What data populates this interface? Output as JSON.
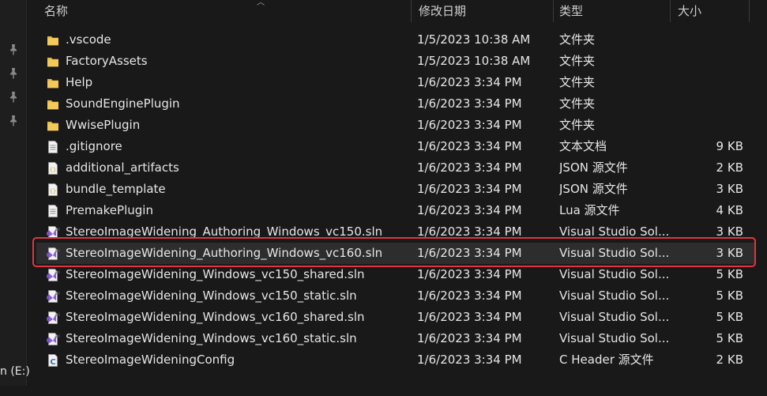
{
  "header": {
    "name": "名称",
    "modified": "修改日期",
    "type": "类型",
    "size": "大小"
  },
  "sidebar": {
    "drive_label": "n (E:)"
  },
  "colors": {
    "folder": "#e8b84a",
    "vs_purple": "#7a4fc2",
    "highlight": "#e0353f"
  },
  "files": [
    {
      "name": ".vscode",
      "modified": "1/5/2023 10:38 AM",
      "type": "文件夹",
      "size": "",
      "icon": "folder-icon"
    },
    {
      "name": "FactoryAssets",
      "modified": "1/5/2023 10:38 AM",
      "type": "文件夹",
      "size": "",
      "icon": "folder-icon"
    },
    {
      "name": "Help",
      "modified": "1/6/2023 3:34 PM",
      "type": "文件夹",
      "size": "",
      "icon": "folder-icon"
    },
    {
      "name": "SoundEnginePlugin",
      "modified": "1/6/2023 3:34 PM",
      "type": "文件夹",
      "size": "",
      "icon": "folder-icon"
    },
    {
      "name": "WwisePlugin",
      "modified": "1/6/2023 3:34 PM",
      "type": "文件夹",
      "size": "",
      "icon": "folder-icon"
    },
    {
      "name": ".gitignore",
      "modified": "1/6/2023 3:34 PM",
      "type": "文本文档",
      "size": "9 KB",
      "icon": "text-file-icon"
    },
    {
      "name": "additional_artifacts",
      "modified": "1/6/2023 3:34 PM",
      "type": "JSON 源文件",
      "size": "2 KB",
      "icon": "json-file-icon"
    },
    {
      "name": "bundle_template",
      "modified": "1/6/2023 3:34 PM",
      "type": "JSON 源文件",
      "size": "3 KB",
      "icon": "json-file-icon"
    },
    {
      "name": "PremakePlugin",
      "modified": "1/6/2023 3:34 PM",
      "type": "Lua 源文件",
      "size": "4 KB",
      "icon": "text-file-icon"
    },
    {
      "name": "StereoImageWidening_Authoring_Windows_vc150.sln",
      "modified": "1/6/2023 3:34 PM",
      "type": "Visual Studio Sol...",
      "size": "3 KB",
      "icon": "vs-solution-icon"
    },
    {
      "name": "StereoImageWidening_Authoring_Windows_vc160.sln",
      "modified": "1/6/2023 3:34 PM",
      "type": "Visual Studio Sol...",
      "size": "3 KB",
      "icon": "vs-solution-icon",
      "selected": true
    },
    {
      "name": "StereoImageWidening_Windows_vc150_shared.sln",
      "modified": "1/6/2023 3:34 PM",
      "type": "Visual Studio Sol...",
      "size": "5 KB",
      "icon": "vs-solution-icon"
    },
    {
      "name": "StereoImageWidening_Windows_vc150_static.sln",
      "modified": "1/6/2023 3:34 PM",
      "type": "Visual Studio Sol...",
      "size": "5 KB",
      "icon": "vs-solution-icon"
    },
    {
      "name": "StereoImageWidening_Windows_vc160_shared.sln",
      "modified": "1/6/2023 3:34 PM",
      "type": "Visual Studio Sol...",
      "size": "5 KB",
      "icon": "vs-solution-icon"
    },
    {
      "name": "StereoImageWidening_Windows_vc160_static.sln",
      "modified": "1/6/2023 3:34 PM",
      "type": "Visual Studio Sol...",
      "size": "5 KB",
      "icon": "vs-solution-icon"
    },
    {
      "name": "StereoImageWideningConfig",
      "modified": "1/6/2023 3:34 PM",
      "type": "C Header 源文件",
      "size": "2 KB",
      "icon": "c-header-file-icon"
    }
  ]
}
